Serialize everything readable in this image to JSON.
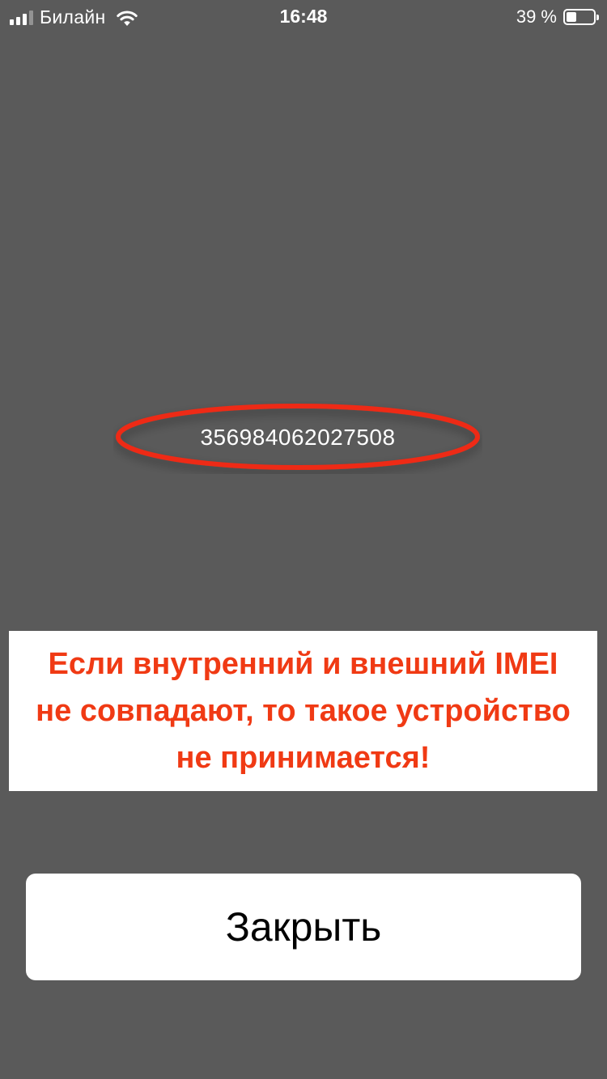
{
  "status_bar": {
    "carrier": "Билайн",
    "time": "16:48",
    "battery_percent": "39 %",
    "battery_level": 0.39,
    "signal_icon": "cellular-signal-icon",
    "wifi_icon": "wifi-icon",
    "battery_icon": "battery-icon"
  },
  "imei": {
    "value": "356984062027508",
    "highlight_color": "#ee2a12"
  },
  "warning": {
    "lines": [
      "Если внутренний и внешний IMEI",
      "не совпадают, то такое устройство",
      "не принимается!"
    ],
    "color": "#f03a14"
  },
  "actions": {
    "close_label": "Закрыть"
  },
  "colors": {
    "background": "#5a5a5a",
    "card": "#ffffff"
  }
}
